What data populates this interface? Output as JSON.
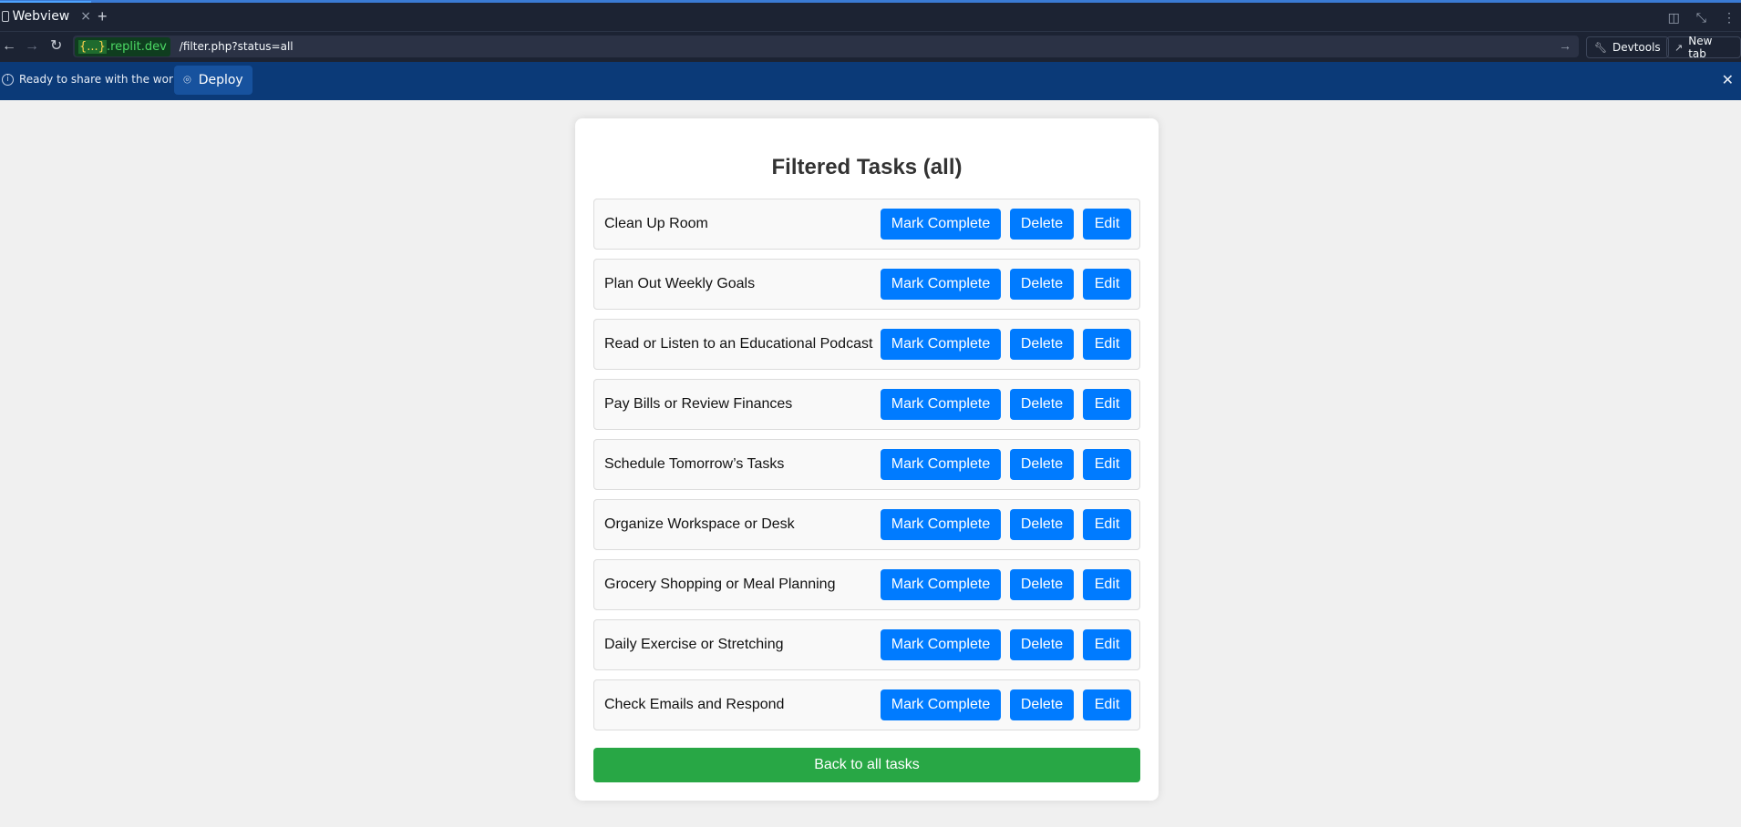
{
  "browser": {
    "tab_title": "Webview",
    "tab_close": "×",
    "tab_add": "+",
    "url_host_brace": "{...}",
    "url_host_domain": ".replit.dev",
    "url_path": "/filter.php?status=all",
    "devtools_label": "Devtools",
    "newtab_label": "New tab"
  },
  "deploy_bar": {
    "message": "Ready to share with the world?",
    "deploy_label": "Deploy"
  },
  "page": {
    "title": "Filtered Tasks (all)",
    "tasks": [
      {
        "name": "Clean Up Room"
      },
      {
        "name": "Plan Out Weekly Goals"
      },
      {
        "name": "Read or Listen to an Educational Podcast"
      },
      {
        "name": "Pay Bills or Review Finances"
      },
      {
        "name": "Schedule Tomorrow’s Tasks"
      },
      {
        "name": "Organize Workspace or Desk"
      },
      {
        "name": "Grocery Shopping or Meal Planning"
      },
      {
        "name": "Daily Exercise or Stretching"
      },
      {
        "name": "Check Emails and Respond"
      }
    ],
    "mark_complete_label": "Mark Complete",
    "delete_label": "Delete",
    "edit_label": "Edit",
    "back_label": "Back to all tasks"
  },
  "colors": {
    "primary": "#007bff",
    "success": "#28a745",
    "deploy_bar": "#0b3a78",
    "chrome": "#1c2333"
  }
}
